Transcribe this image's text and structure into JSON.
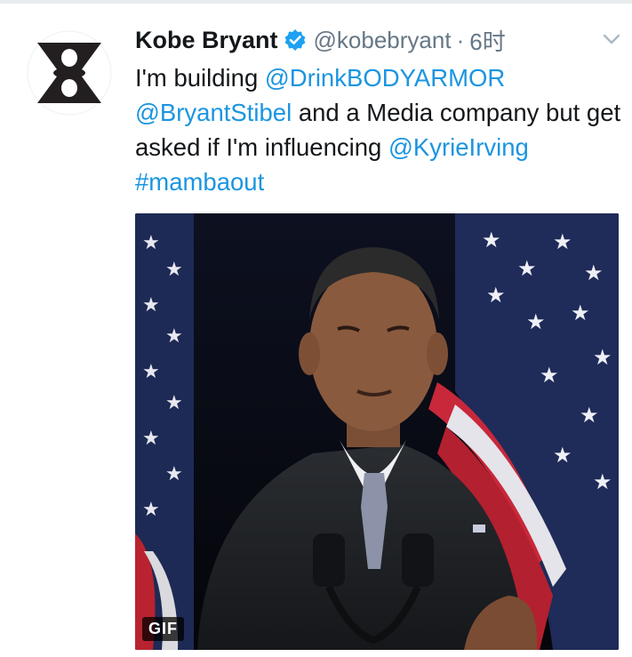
{
  "tweet": {
    "display_name": "Kobe Bryant",
    "handle": "@kobebryant",
    "separator": "·",
    "timestamp": "6时",
    "text_segments": [
      {
        "text": "I'm building ",
        "link": false
      },
      {
        "text": "@DrinkBODYARMOR",
        "link": true
      },
      {
        "text": " ",
        "link": false
      },
      {
        "text": "@BryantStibel",
        "link": true
      },
      {
        "text": " and a Media company but get asked if I'm influencing ",
        "link": false
      },
      {
        "text": "@KyrieIrving",
        "link": true
      },
      {
        "text": " ",
        "link": false
      },
      {
        "text": "#mambaout",
        "link": true
      }
    ]
  },
  "media": {
    "badge": "GIF"
  },
  "icons": {
    "avatar": "hourglass-logo-icon",
    "verified": "verified-badge-icon",
    "menu": "chevron-down-icon"
  },
  "colors": {
    "link": "#1b95e0",
    "secondary_text": "#657786",
    "verified": "#1da1f2"
  }
}
